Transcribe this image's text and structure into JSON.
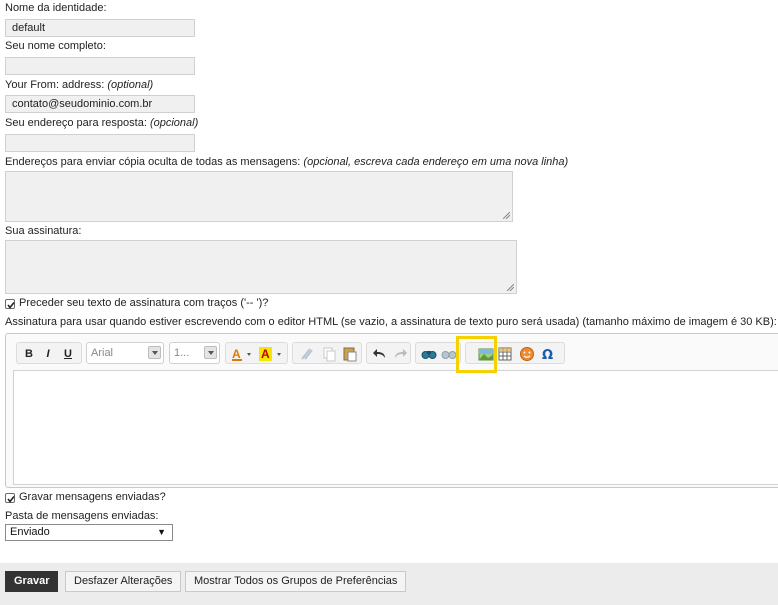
{
  "form": {
    "identity_name_label": "Nome da identidade:",
    "identity_name_value": "default",
    "full_name_label": "Seu nome completo:",
    "full_name_value": "",
    "from_label": "Your From: address:",
    "from_optional": "(optional)",
    "from_value": "contato@seudominio.com.br",
    "reply_label": "Seu endereço para resposta:",
    "reply_optional": "(opcional)",
    "reply_value": "",
    "bcc_label": "Endereços para enviar cópia oculta de todas as mensagens:",
    "bcc_hint": "(opcional, escreva cada endereço em uma nova linha)",
    "signature_label": "Sua assinatura:",
    "dashes_label": "Preceder seu texto de assinatura com traços ('-- ')?",
    "dashes_checked": true,
    "html_signature_label": "Assinatura para usar quando estiver escrevendo com o editor HTML (se vazio, a assinatura de texto puro será usada) (tamanho máximo de imagem é 30 KB):",
    "save_sent_label": "Gravar mensagens enviadas?",
    "save_sent_checked": true,
    "sent_folder_label": "Pasta de mensagens enviadas:",
    "sent_folder_value": "Enviado"
  },
  "editor": {
    "bold": "B",
    "italic": "I",
    "underline": "U",
    "font_family": "Arial",
    "font_size": "1...",
    "highlight_color": "#f5d100"
  },
  "buttons": {
    "save": "Gravar",
    "undo": "Desfazer Alterações",
    "show_all": "Mostrar Todos os Grupos de Preferências"
  }
}
